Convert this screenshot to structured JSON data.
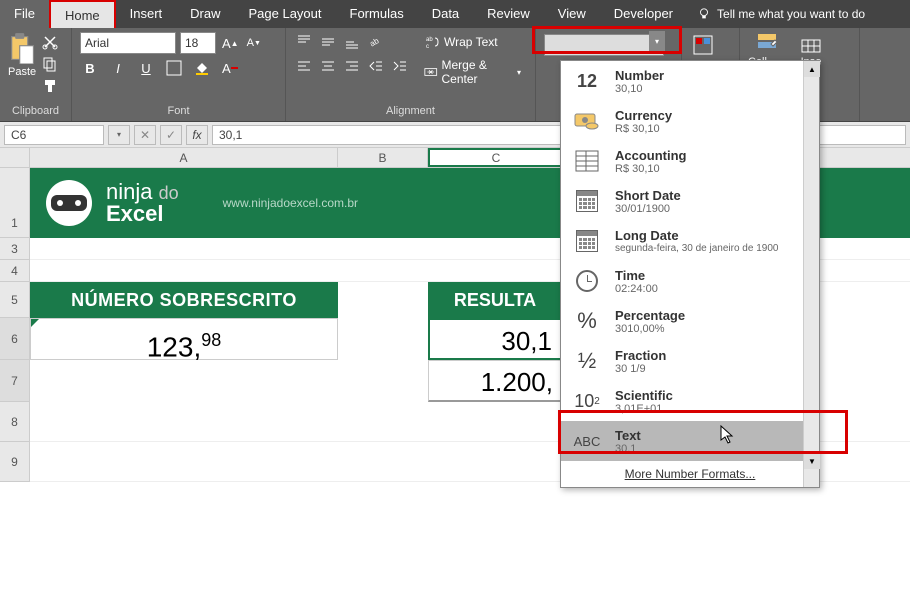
{
  "menu": {
    "file": "File",
    "home": "Home",
    "insert": "Insert",
    "draw": "Draw",
    "page_layout": "Page Layout",
    "formulas": "Formulas",
    "data": "Data",
    "review": "Review",
    "view": "View",
    "developer": "Developer",
    "tell_me": "Tell me what you want to do"
  },
  "ribbon": {
    "clipboard": {
      "paste": "Paste",
      "label": "Clipboard"
    },
    "font": {
      "family": "Arial",
      "size": "18",
      "label": "Font"
    },
    "alignment": {
      "wrap": "Wrap Text",
      "merge": "Merge & Center",
      "label": "Alignment"
    },
    "styles": {
      "cell_styles": "Cell Styles",
      "insert": "Inse"
    }
  },
  "formula_bar": {
    "name_box": "C6",
    "value": "30,1"
  },
  "columns": {
    "a": "A",
    "b": "B",
    "c": "C"
  },
  "rows": {
    "r1": "1",
    "r3": "3",
    "r4": "4",
    "r5": "5",
    "r6": "6",
    "r7": "7",
    "r8": "8",
    "r9": "9"
  },
  "banner": {
    "line1a": "ninja ",
    "line1b": "do",
    "line2": "Excel",
    "url": "www.ninjadoexcel.com.br"
  },
  "headers": {
    "a": "NÚMERO SOBRESCRITO",
    "c": "RESULTA"
  },
  "cells": {
    "a6_base": "123,",
    "a6_sup": "98",
    "c6": "30,1",
    "c7": "1.200,"
  },
  "format_menu": {
    "number": {
      "name": "Number",
      "sample": "30,10"
    },
    "currency": {
      "name": "Currency",
      "sample": "R$ 30,10"
    },
    "accounting": {
      "name": "Accounting",
      "sample": "R$ 30,10"
    },
    "short_date": {
      "name": "Short Date",
      "sample": "30/01/1900"
    },
    "long_date": {
      "name": "Long Date",
      "sample": "segunda-feira, 30 de janeiro de 1900"
    },
    "time": {
      "name": "Time",
      "sample": "02:24:00"
    },
    "percentage": {
      "name": "Percentage",
      "sample": "3010,00%"
    },
    "fraction": {
      "name": "Fraction",
      "sample": "30 1/9"
    },
    "scientific": {
      "name": "Scientific",
      "sample": "3,01E+01"
    },
    "text": {
      "name": "Text",
      "sample": "30,1"
    },
    "more": "More Number Formats..."
  },
  "icons": {
    "number": "12",
    "percentage": "%",
    "fraction": "½",
    "scientific": "10²",
    "text": "ABC"
  }
}
